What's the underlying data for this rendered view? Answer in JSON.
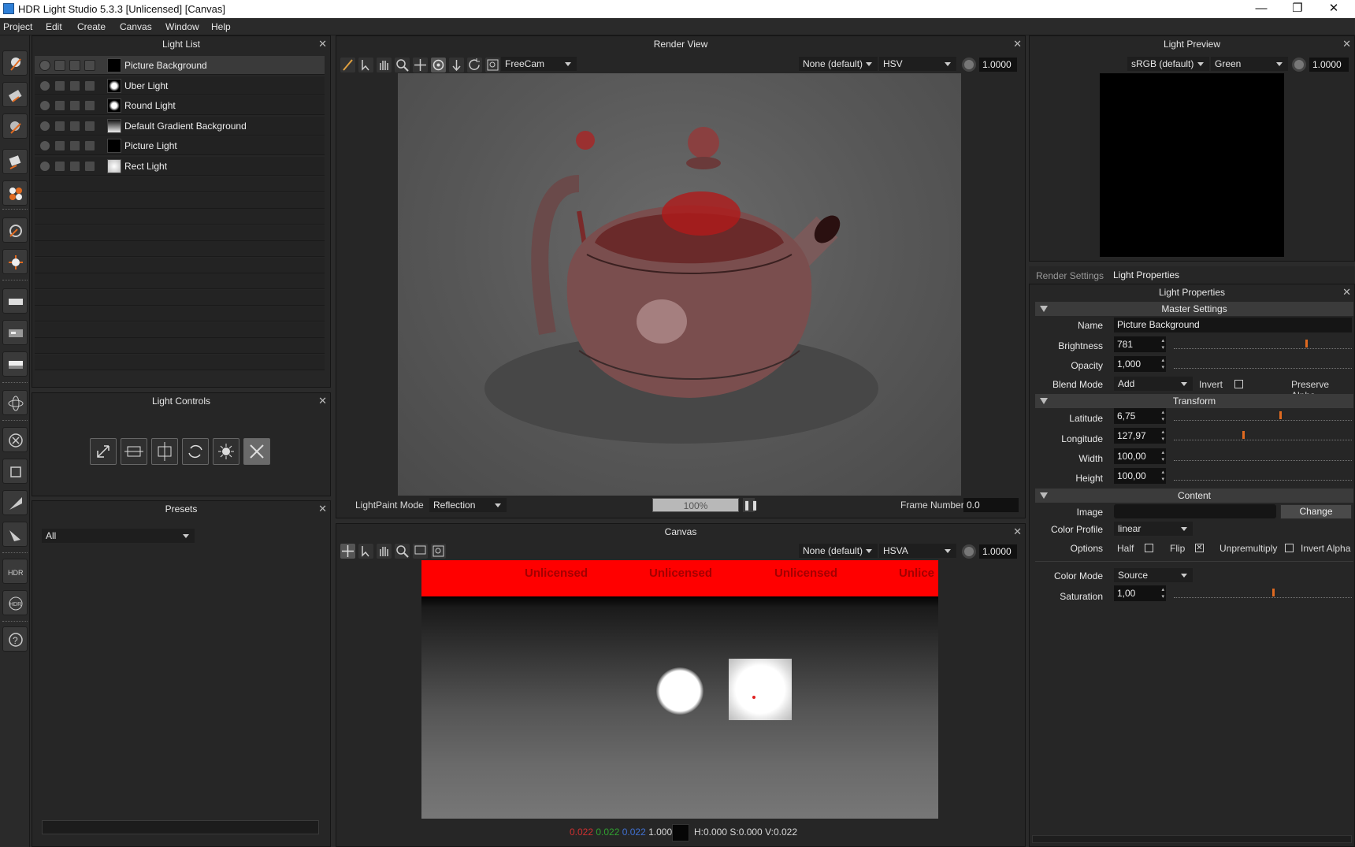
{
  "window": {
    "title": "HDR Light Studio 5.3.3 [Unlicensed] [Canvas]",
    "minimize": "—",
    "restore": "❐",
    "close": "✕"
  },
  "menu": [
    "Project",
    "Edit",
    "Create",
    "Canvas",
    "Window",
    "Help"
  ],
  "light_list": {
    "title": "Light List",
    "items": [
      {
        "label": "Picture Background",
        "thumb": "black",
        "selected": true
      },
      {
        "label": "Uber Light",
        "thumb": "spot"
      },
      {
        "label": "Round Light",
        "thumb": "spot"
      },
      {
        "label": "Default Gradient Background",
        "thumb": "gradient"
      },
      {
        "label": "Picture Light",
        "thumb": "black"
      },
      {
        "label": "Rect Light",
        "thumb": "white"
      }
    ]
  },
  "light_controls": {
    "title": "Light Controls"
  },
  "presets": {
    "title": "Presets",
    "filter": "All"
  },
  "render_view": {
    "title": "Render View",
    "camera": "FreeCam",
    "lut": "None (default)",
    "mode": "HSV",
    "exposure": "1.0000",
    "lightpaint_label": "LightPaint Mode",
    "lightpaint_value": "Reflection",
    "progress_text": "100%",
    "progress": 1.0,
    "frame_label": "Frame Number",
    "frame_value": "0.0"
  },
  "canvas": {
    "title": "Canvas",
    "lut": "None (default)",
    "mode": "HSVA",
    "exposure": "1.0000",
    "watermark": [
      "Unlicensed",
      "Unlicensed",
      "Unlicensed",
      "Unlice"
    ],
    "status": {
      "r": "0.022",
      "g": "0.022",
      "b": "0.022",
      "a": "1.000",
      "hsv": "H:0.000 S:0.000 V:0.022"
    }
  },
  "light_preview": {
    "title": "Light Preview",
    "colorspace": "sRGB (default)",
    "channel": "Green",
    "exposure": "1.0000"
  },
  "tabs": [
    "Render Settings",
    "Light Properties"
  ],
  "props": {
    "title": "Light Properties",
    "master": "Master Settings",
    "name_label": "Name",
    "name_value": "Picture Background",
    "brightness_label": "Brightness",
    "brightness": "781",
    "opacity_label": "Opacity",
    "opacity": "1,000",
    "blend_label": "Blend Mode",
    "blend": "Add",
    "invert_label": "Invert",
    "preserve_alpha_label": "Preserve Alpha",
    "transform": "Transform",
    "latitude_label": "Latitude",
    "latitude": "6,75",
    "longitude_label": "Longitude",
    "longitude": "127,97",
    "width_label": "Width",
    "width": "100,00",
    "height_label": "Height",
    "height": "100,00",
    "content": "Content",
    "image_label": "Image",
    "change_label": "Change",
    "color_profile_label": "Color Profile",
    "color_profile": "linear",
    "options_label": "Options",
    "half_label": "Half",
    "flip_label": "Flip",
    "unpremultiply_label": "Unpremultiply",
    "invert_alpha_label": "Invert Alpha",
    "color_mode_label": "Color Mode",
    "color_mode": "Source",
    "saturation_label": "Saturation",
    "saturation": "1,00",
    "slider_levels": {
      "brightness": 0.75,
      "latitude": 0.6,
      "longitude": 0.39,
      "saturation": 0.56
    },
    "flip_checked": true
  },
  "colors": {
    "accent": "#e06a20",
    "watermark_bar": "#ff0000",
    "teapot": "#7a3a3a"
  }
}
